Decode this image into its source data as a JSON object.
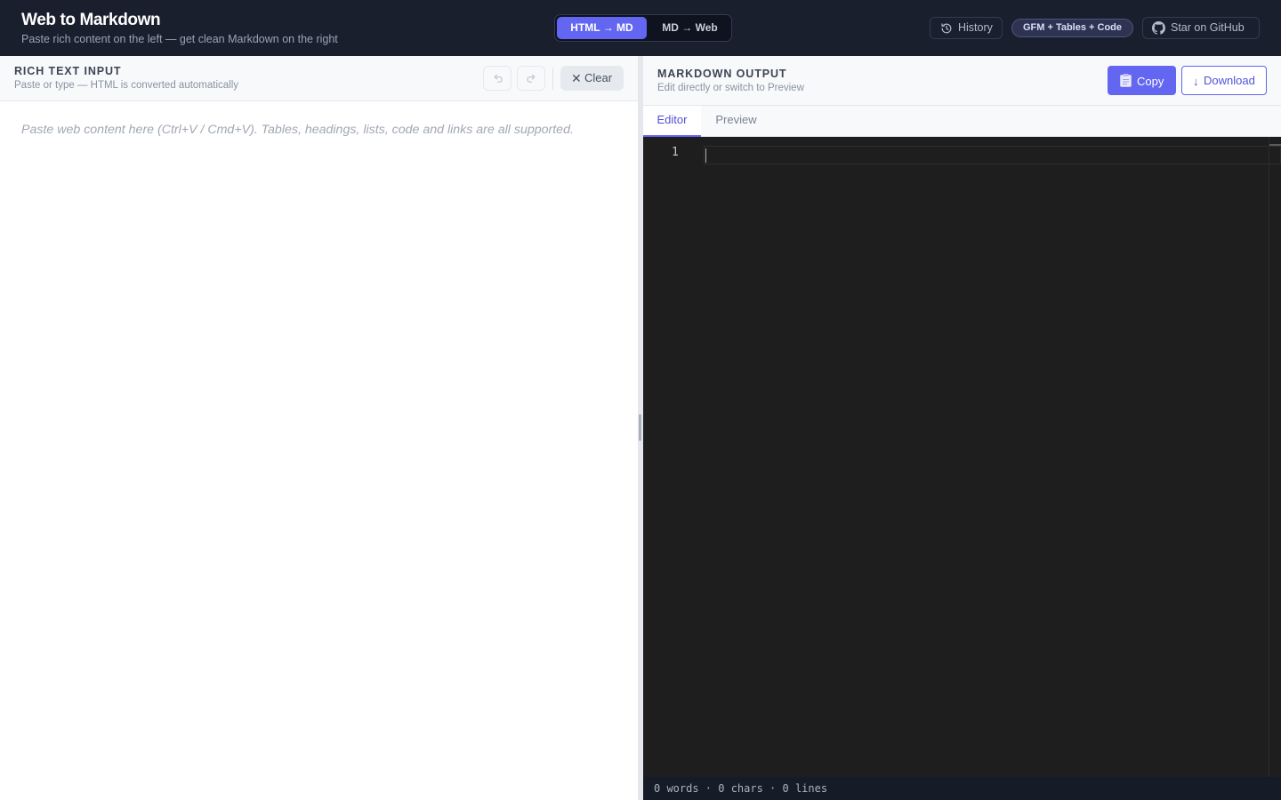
{
  "header": {
    "title": "Web to Markdown",
    "subtitle": "Paste rich content on the left — get clean Markdown on the right",
    "modes": [
      {
        "label": "HTML → MD",
        "active": true
      },
      {
        "label": "MD → Web",
        "active": false
      }
    ],
    "history_label": "History",
    "badge": "GFM + Tables + Code",
    "github_label": "Star on GitHub"
  },
  "input_pane": {
    "title": "RICH TEXT INPUT",
    "subtitle": "Paste or type — HTML is converted automatically",
    "clear_label": "Clear",
    "placeholder": "Paste web content here (Ctrl+V / Cmd+V). Tables, headings, lists, code and links are all supported."
  },
  "output_pane": {
    "title": "MARKDOWN OUTPUT",
    "subtitle": "Edit directly or switch to Preview",
    "copy_label": "Copy",
    "download_label": "Download",
    "tabs": [
      {
        "label": "Editor",
        "active": true
      },
      {
        "label": "Preview",
        "active": false
      }
    ],
    "line_number": "1",
    "content": "",
    "status": "0 words · 0 chars · 0 lines"
  },
  "colors": {
    "accent": "#6366f1",
    "header_bg": "#1a1f2e",
    "editor_bg": "#1e1e1e"
  }
}
